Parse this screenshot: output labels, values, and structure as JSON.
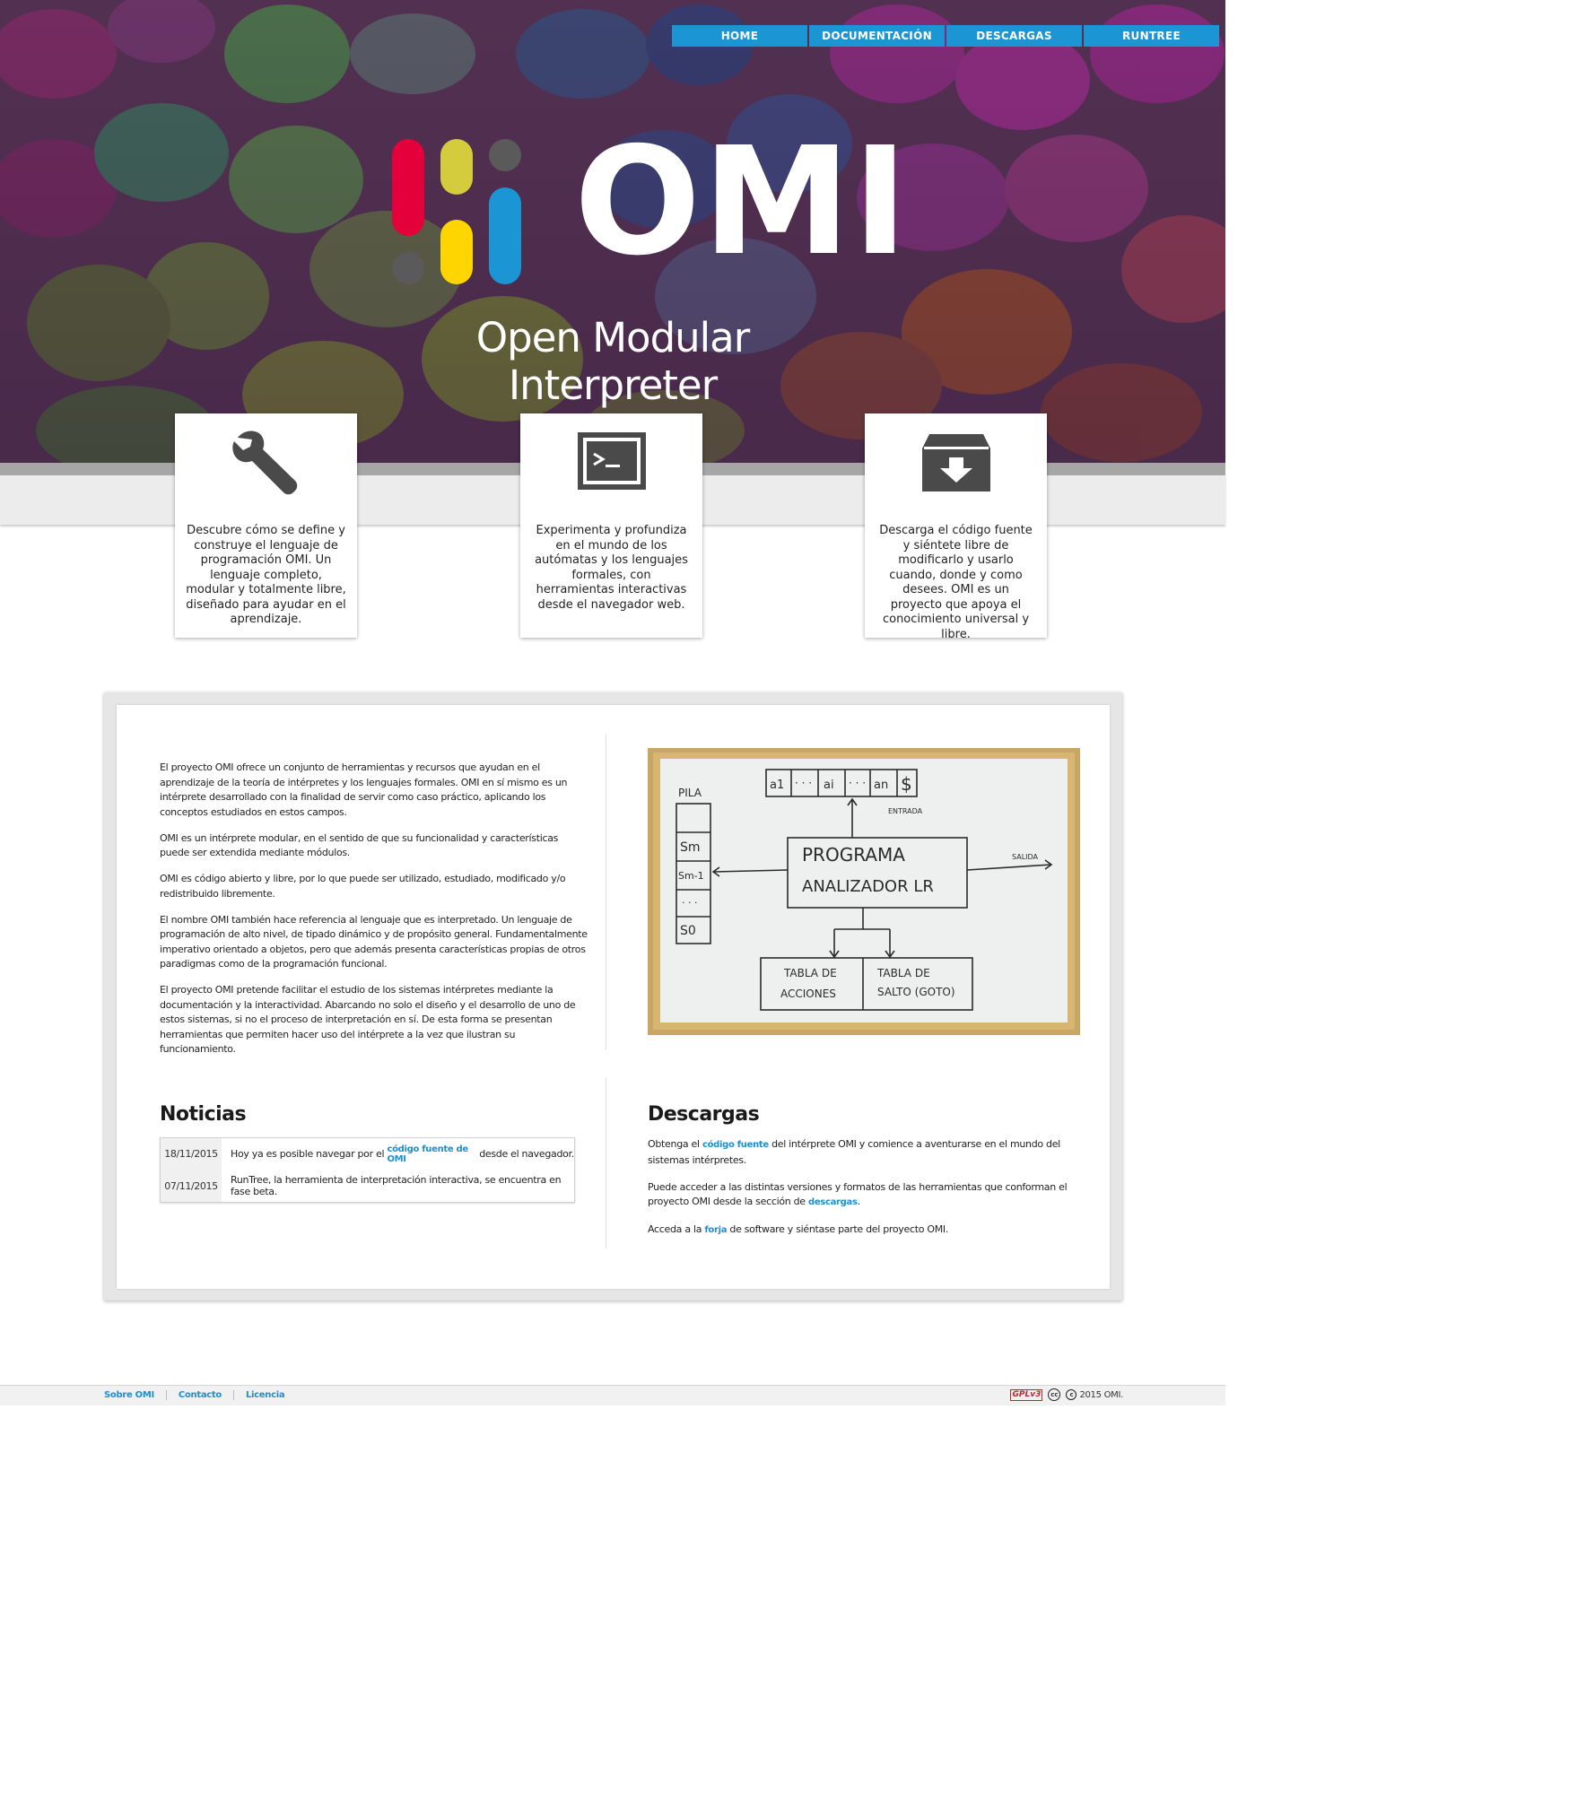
{
  "nav": {
    "items": [
      {
        "label": "HOME"
      },
      {
        "label": "DOCUMENTACIÓN"
      },
      {
        "label": "DESCARGAS"
      },
      {
        "label": "RUNTREE"
      }
    ]
  },
  "hero": {
    "logo_text": "OMI",
    "subtitle": "Open Modular Interpreter",
    "logo_colors": [
      "#e4003a",
      "#d4cc3c",
      "#5a5a5a",
      "#ffd500",
      "#1b95d4"
    ]
  },
  "features": [
    {
      "icon": "wrench-icon",
      "text": "Descubre cómo se define y construye el lenguaje de programación OMI. Un lenguaje completo, modular y totalmente libre, diseñado para ayudar en el aprendizaje."
    },
    {
      "icon": "terminal-icon",
      "text": "Experimenta y profundiza en el mundo de los autómatas y los lenguajes formales, con herramientas interactivas desde el navegador web."
    },
    {
      "icon": "download-box-icon",
      "text": "Descarga el código fuente y siéntete libre de modificarlo y usarlo cuando, donde y como desees. OMI es un proyecto que apoya el conocimiento universal y libre."
    }
  ],
  "intro": {
    "paragraphs": [
      "El proyecto OMI ofrece un conjunto de herramientas y recursos que ayudan en el aprendizaje de la teoría de intérpretes y los lenguajes formales. OMI en sí mismo es un intérprete desarrollado con la finalidad de servir como caso práctico, aplicando los conceptos estudiados en estos campos.",
      "OMI es un intérprete modular, en el sentido de que su funcionalidad y características puede ser extendida mediante módulos.",
      "OMI es código abierto y libre, por lo que puede ser utilizado, estudiado, modificado y/o redistribuido libremente.",
      "El nombre OMI también hace referencia al lenguaje que es interpretado. Un lenguaje de programación de alto nivel, de tipado dinámico y de propósito general. Fundamentalmente imperativo orientado a objetos, pero que además presenta características propias de otros paradigmas como de la programación funcional.",
      "El proyecto OMI pretende facilitar el estudio de los sistemas intérpretes mediante la documentación y la interactividad. Abarcando no solo el diseño y el desarrollo de uno de estos sistemas, si no el proceso de interpretación en sí. De esta forma se presentan herramientas que permiten hacer uso del intérprete a la vez que ilustran su funcionamiento."
    ]
  },
  "whiteboard": {
    "pila": "PILA",
    "stack": [
      "Sm",
      "Sm-1",
      "· · ·",
      "S0"
    ],
    "input": [
      "a1",
      "· · ·",
      "ai",
      "· · ·",
      "an",
      "$"
    ],
    "entrada": "ENTRADA",
    "programa_1": "PROGRAMA",
    "programa_2": "ANALIZADOR  LR",
    "salida": "SALIDA",
    "acciones_1": "TABLA  DE",
    "acciones_2": "ACCIONES",
    "salto_1": "TABLA  DE",
    "salto_2": "SALTO (GOTO)"
  },
  "news": {
    "title": "Noticias",
    "items": [
      {
        "date": "18/11/2015",
        "before": "Hoy ya es posible navegar por el ",
        "link": "código fuente de OMI",
        "after": " desde el navegador."
      },
      {
        "date": "07/11/2015",
        "before": "RunTree, la herramienta de interpretación interactiva, se encuentra en fase beta.",
        "link": "",
        "after": ""
      }
    ]
  },
  "downloads": {
    "title": "Descargas",
    "p1_before": "Obtenga el ",
    "p1_link": "código fuente",
    "p1_after": " del intérprete OMI y comience a aventurarse en el mundo del sistemas intérpretes.",
    "p2_before": "Puede acceder a las distintas versiones y formatos de las herramientas que conforman el proyecto OMI desde la sección de ",
    "p2_link": "descargas",
    "p2_after": ".",
    "p3_before": "Acceda a la ",
    "p3_link": "forja",
    "p3_after": " de software y siéntase parte del proyecto OMI."
  },
  "footer": {
    "links": [
      {
        "label": "Sobre OMI"
      },
      {
        "label": "Contacto"
      },
      {
        "label": "Licencia"
      }
    ],
    "gpl": "GPLv3",
    "cc": "cc",
    "copyright": "2015 OMI."
  }
}
